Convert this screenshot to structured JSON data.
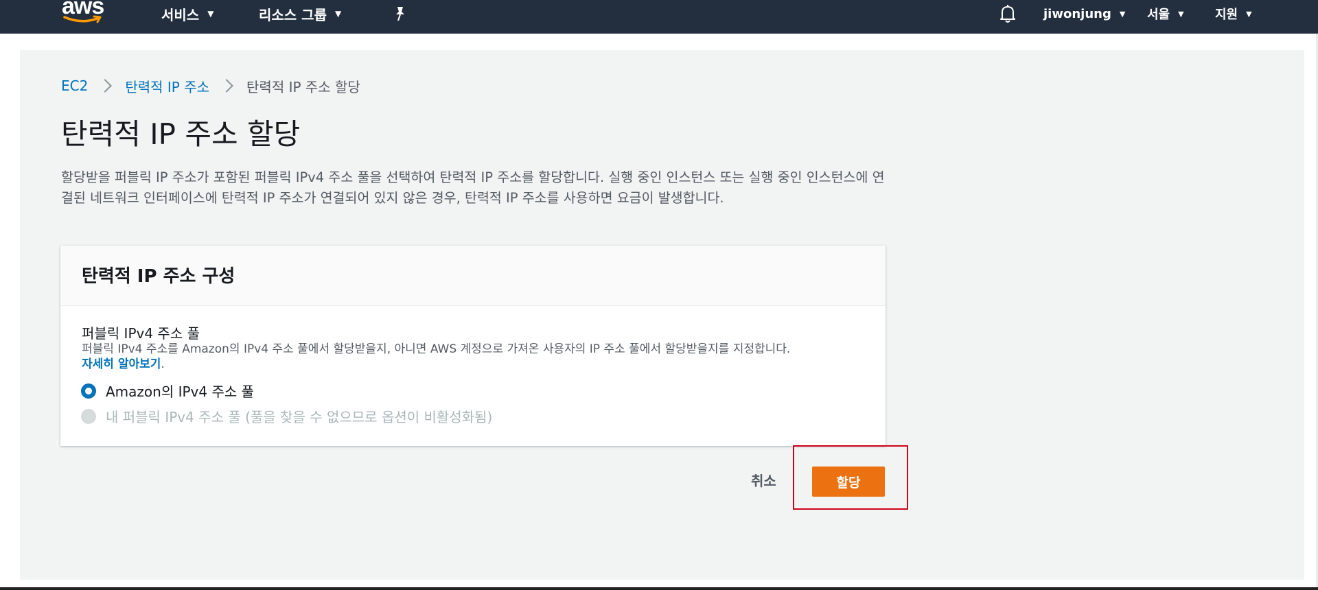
{
  "nav": {
    "logo": "aws",
    "services": "서비스",
    "resource_groups": "리소스 그룹",
    "pin_icon": "pin-icon",
    "bell_icon": "bell-icon",
    "user": "jiwonjung",
    "region": "서울",
    "support": "지원",
    "caret_icon": "caret-down-icon"
  },
  "breadcrumb": {
    "items": [
      "EC2",
      "탄력적 IP 주소",
      "탄력적 IP 주소 할당"
    ]
  },
  "page": {
    "title": "탄력적 IP 주소 할당",
    "description": "할당받을 퍼블릭 IP 주소가 포함된 퍼블릭 IPv4 주소 풀을 선택하여 탄력적 IP 주소를 할당합니다. 실행 중인 인스턴스 또는 실행 중인 인스턴스에 연결된 네트워크 인터페이스에 탄력적 IP 주소가 연결되어 있지 않은 경우, 탄력적 IP 주소를 사용하면 요금이 발생합니다."
  },
  "panel": {
    "title": "탄력적 IP 주소 구성",
    "field_label": "퍼블릭 IPv4 주소 풀",
    "field_desc": "퍼블릭 IPv4 주소를 Amazon의 IPv4 주소 풀에서 할당받을지, 아니면 AWS 계정으로 가져온 사용자의 IP 주소 풀에서 할당받을지를 지정합니다.",
    "learn_more": "자세히 알아보기",
    "learn_more_suffix": ".",
    "options": [
      {
        "label": "Amazon의 IPv4 주소 풀",
        "selected": true,
        "disabled": false
      },
      {
        "label": "내 퍼블릭 IPv4 주소 풀 (풀을 찾을 수 없으므로 옵션이 비활성화됨)",
        "selected": false,
        "disabled": true
      }
    ]
  },
  "actions": {
    "cancel": "취소",
    "allocate": "할당"
  },
  "colors": {
    "nav_bg": "#232f3e",
    "link": "#0073bb",
    "primary": "#ec7211",
    "highlight": "#d0021b",
    "aws_smile": "#ff9900"
  }
}
